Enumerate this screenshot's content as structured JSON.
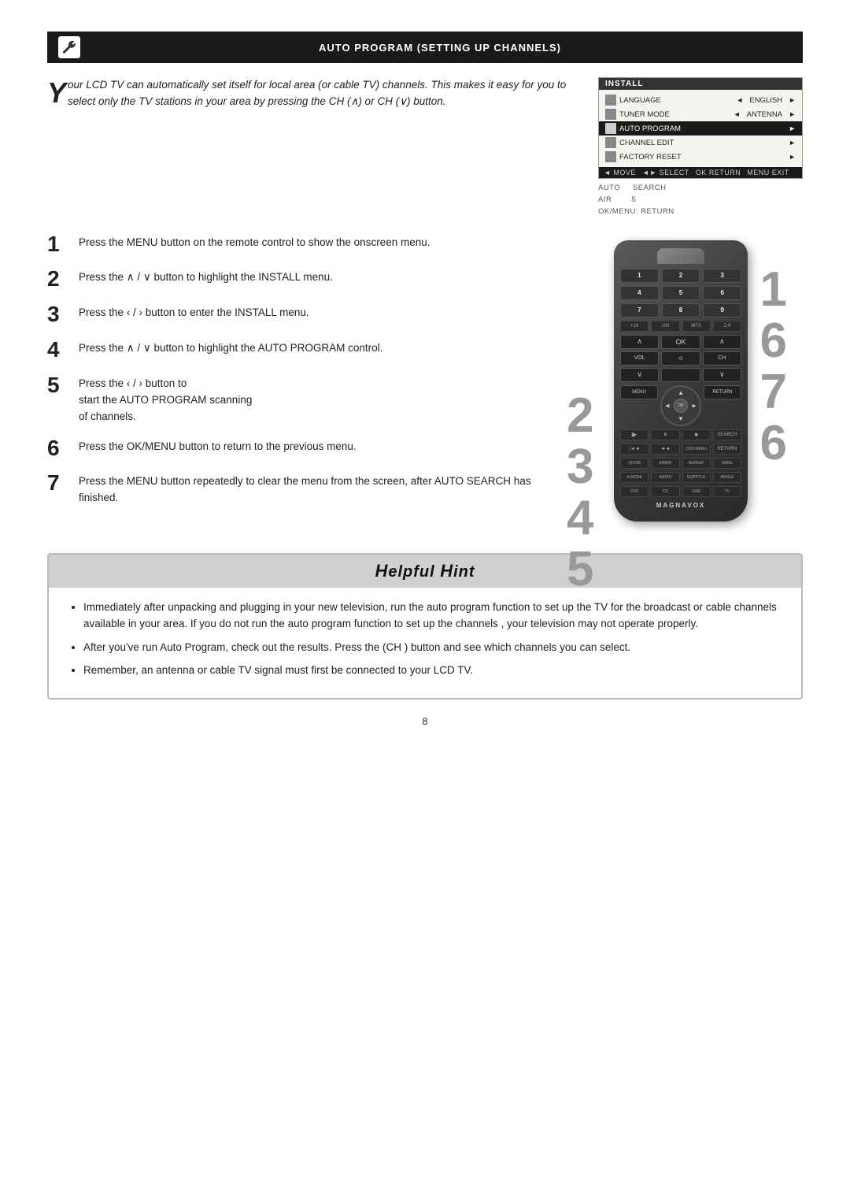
{
  "header": {
    "title": "Auto Program (Setting Up Channels)",
    "icon_alt": "settings-icon"
  },
  "intro": {
    "drop_cap": "Y",
    "text": "our LCD TV can automatically set itself for local area (or cable TV) channels. This makes it easy for you to select only the TV stations in your area by pressing the CH (∧) or CH (∨) button."
  },
  "tv_menu": {
    "title": "INSTALL",
    "items": [
      {
        "label": "LANGUAGE",
        "value": "ENGLISH",
        "has_arrows": true,
        "selected": false,
        "has_icon": true
      },
      {
        "label": "TUNER MODE",
        "value": "ANTENNA",
        "has_arrows": true,
        "selected": false,
        "has_icon": true
      },
      {
        "label": "AUTO PROGRAM",
        "value": "",
        "has_arrows": true,
        "selected": true,
        "has_icon": true
      },
      {
        "label": "CHANNEL EDIT",
        "value": "",
        "has_arrows": true,
        "selected": false,
        "has_icon": true
      },
      {
        "label": "FACTORY RESET",
        "value": "",
        "has_arrows": true,
        "selected": false,
        "has_icon": true
      }
    ],
    "nav_bar": "◄ MOVE  ◄► SELECT  OK RETURN  MENU EXIT"
  },
  "tv_side": {
    "lines": [
      "AUTO   SEARCH",
      "AIR      5",
      "OK/MENU: Return"
    ]
  },
  "steps": [
    {
      "number": "1",
      "text": "Press the MENU button on the remote control to show the onscreen menu."
    },
    {
      "number": "2",
      "text": "Press the ∧ / ∨ button to highlight the INSTALL menu."
    },
    {
      "number": "3",
      "text": "Press the ‹ / › button to enter the INSTALL menu."
    },
    {
      "number": "4",
      "text": "Press the ∧ / ∨ button to highlight the AUTO PROGRAM control."
    },
    {
      "number": "5",
      "text": "Press the ‹ / › button to start the AUTO PROGRAM scanning of channels."
    },
    {
      "number": "6",
      "text": "Press the OK/MENU button to return to the previous menu."
    },
    {
      "number": "7",
      "text": "Press the MENU button repeatedly to clear the menu from the screen, after AUTO SEARCH has finished."
    }
  ],
  "callout_right": [
    "1",
    "6",
    "7",
    "6"
  ],
  "callout_left": [
    "2",
    "3",
    "4",
    "5"
  ],
  "hint": {
    "title": "Helpful Hint",
    "bullets": [
      "Immediately after unpacking and plugging in your new television, run the auto program function to set up the TV for the broadcast or cable channels available in your area. If you do not run the auto program function to set up the channels , your television may not operate properly.",
      "After you've run Auto Program, check out  the results. Press the (CH ) button and see which channels you can select.",
      "Remember, an antenna or cable TV signal must first be connected to your LCD TV."
    ]
  },
  "page_number": "8"
}
